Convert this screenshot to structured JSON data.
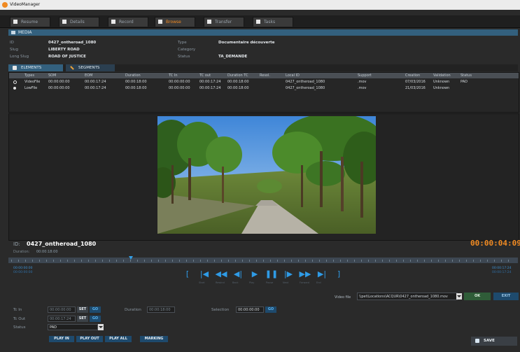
{
  "window": {
    "title": "VideoManager"
  },
  "tabs": [
    {
      "label": "Resume"
    },
    {
      "label": "Details"
    },
    {
      "label": "Record"
    },
    {
      "label": "Browse"
    },
    {
      "label": "Transfer"
    },
    {
      "label": "Tasks"
    }
  ],
  "active_tab": "Browse",
  "media": {
    "header": "MEDIA",
    "id_label": "ID",
    "id_value": "0427_ontheroad_1080",
    "slug_label": "Slug",
    "slug_value": "LIBERTY ROAD",
    "longslug_label": "Long Slug",
    "longslug_value": "ROAD OF JUSTICE",
    "type_label": "Type",
    "type_value": "Documentaire découverte",
    "category_label": "Category",
    "category_value": "",
    "status_label": "Status",
    "status_value": "TA_DEMANDE"
  },
  "subtabs": [
    {
      "label": "ELEMENTS"
    },
    {
      "label": "SEGMENTS"
    }
  ],
  "table": {
    "columns": [
      "Types",
      "SOM",
      "EOM",
      "Duration",
      "TC In",
      "TC out",
      "Duration TC",
      "Resol.",
      "Local ID",
      "Support",
      "Creation",
      "Validation",
      "Status"
    ],
    "rows": [
      [
        "VideoFile",
        "00:00:00:00",
        "00:00:17:24",
        "00:00:18:00",
        "00:00:00:00",
        "00:00:17:24",
        "00:00:18:00",
        "",
        "0427_ontheroad_1080",
        ".mov",
        "07/03/2016",
        "Unknown",
        "PAD"
      ],
      [
        "LowFile",
        "00:00:00:00",
        "00:00:17:24",
        "00:00:18:00",
        "00:00:00:00",
        "00:00:17:24",
        "00:00:18:00",
        "",
        "0427_ontheroad_1080",
        ".mov",
        "21/03/2016",
        "Unknown",
        ""
      ]
    ]
  },
  "player": {
    "id_label": "ID:",
    "id_value": "0427_ontheroad_1080",
    "timecode": "00:00:04:09",
    "duration_label": "Duration:",
    "duration_value": "00:00:18:00",
    "tl_left_top": "00:00:00:00",
    "tl_left_bottom": "00:00:00:00",
    "tl_right_top": "00:00:17:24",
    "tl_right_bottom": "00:00:17:24",
    "playhead_fraction": 0.24
  },
  "transport": [
    {
      "glyph": "[",
      "label": ""
    },
    {
      "glyph": "|◀",
      "label": "Start"
    },
    {
      "glyph": "◀◀",
      "label": "Rewind"
    },
    {
      "glyph": "◀|",
      "label": "Back"
    },
    {
      "glyph": "▶",
      "label": "Play"
    },
    {
      "glyph": "❚❚",
      "label": "Pause"
    },
    {
      "glyph": "|▶",
      "label": "Next"
    },
    {
      "glyph": "▶▶",
      "label": "Forward"
    },
    {
      "glyph": "▶|",
      "label": "End"
    },
    {
      "glyph": "]",
      "label": ""
    }
  ],
  "videofile": {
    "label": "Video file",
    "path": "\\\\pet\\Locations\\ACQUR\\0427_ontheroad_1080.mov",
    "ok": "OK",
    "exit": "EXIT"
  },
  "controls": {
    "tcin_label": "Tc In",
    "tcin_value": "00:00:00:00",
    "tcout_label": "Tc Out",
    "tcout_value": "00:00:17:24",
    "status_label": "Status",
    "status_value": "PAD",
    "set": "SET",
    "go": "GO",
    "duration_label": "Duration",
    "duration_value": "00:00:18:00",
    "selection_label": "Selection",
    "selection_value": "00:00:00:00",
    "play_in": "PLAY IN",
    "play_out": "PLAY OUT",
    "play_all": "PLAY ALL",
    "marking": "MARKING",
    "save": "SAVE"
  },
  "colors": {
    "accent": "#f08a22",
    "blue": "#2f9be6",
    "header": "#33607e"
  }
}
